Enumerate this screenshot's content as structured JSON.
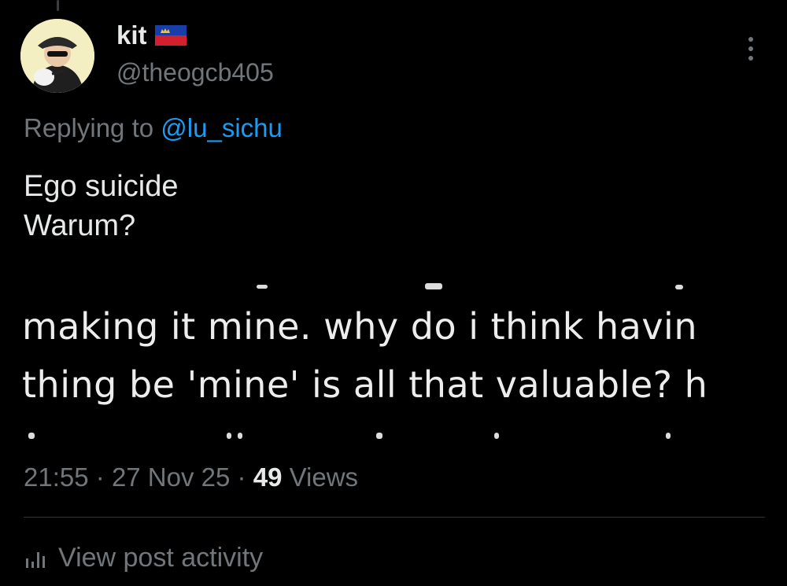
{
  "author": {
    "display_name": "kit",
    "handle": "@theogcb405",
    "flag": "liechtenstein-flag-icon"
  },
  "reply": {
    "prefix": "Replying to",
    "mention": "@lu_sichu"
  },
  "tweet": {
    "lines": [
      "Ego suicide",
      "Warum?"
    ]
  },
  "media": {
    "lines": [
      "making it mine. why do i think havin",
      "thing be 'mine' is all that valuable? h"
    ]
  },
  "meta": {
    "time": "21:55",
    "date": "27 Nov 25",
    "sep": "·",
    "views_count": "49",
    "views_label": "Views"
  },
  "activity": {
    "label": "View post activity",
    "icon": "bar-chart-icon"
  },
  "colors": {
    "background": "#000000",
    "primary_text": "#e7e9ea",
    "secondary_text": "#71767b",
    "link": "#1d9bf0",
    "divider": "#2f3336"
  }
}
